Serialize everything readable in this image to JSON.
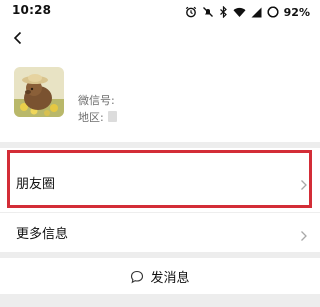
{
  "status_bar": {
    "time": "10:28",
    "battery_percent": "92%",
    "icons": [
      "alarm-icon",
      "mute-icon",
      "bluetooth-icon",
      "wifi-icon",
      "signal-icon",
      "battery-icon"
    ]
  },
  "profile": {
    "wechat_id_label": "微信号:",
    "region_label": "地区:"
  },
  "list": {
    "moments_label": "朋友圈",
    "more_info_label": "更多信息",
    "send_message_label": "发消息"
  },
  "colors": {
    "highlight": "#d32d37",
    "background": "#ededed",
    "card": "#ffffff"
  }
}
